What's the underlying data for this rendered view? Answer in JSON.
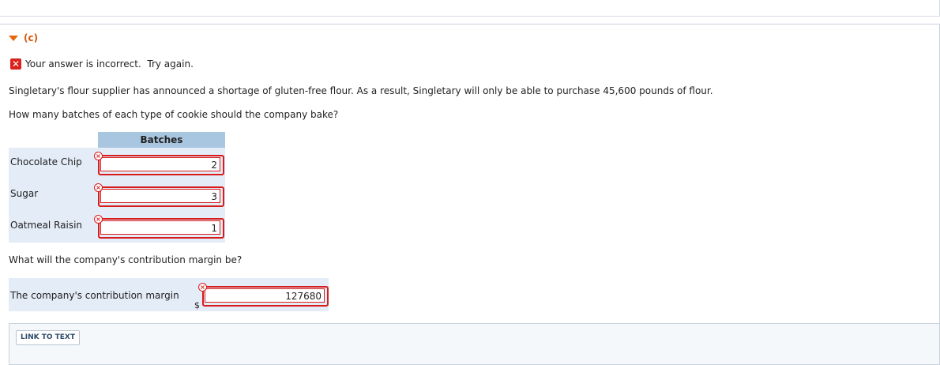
{
  "part": {
    "label": "(c)"
  },
  "feedback": {
    "message": "Your answer is incorrect.  Try again."
  },
  "question": {
    "intro": "Singletary's flour supplier has announced a shortage of gluten-free flour. As a result, Singletary will only be able to purchase 45,600 pounds of flour.",
    "prompt": "How many batches of each type of cookie should the company bake?"
  },
  "batches_table": {
    "header": "Batches",
    "rows": [
      {
        "label": "Chocolate Chip",
        "value": "2"
      },
      {
        "label": "Sugar",
        "value": "3"
      },
      {
        "label": "Oatmeal Raisin",
        "value": "1"
      }
    ]
  },
  "margin_question": {
    "prompt": "What will the company's contribution margin be?"
  },
  "contribution_margin": {
    "label": "The company's contribution margin",
    "currency": "$",
    "value": "127680"
  },
  "link_panel": {
    "button_label": "LINK TO TEXT"
  },
  "colors": {
    "accent_orange": "#d9560a",
    "error_red": "#d81b1b",
    "table_header": "#a9c6e0",
    "row_bg": "#e3ecf7"
  }
}
